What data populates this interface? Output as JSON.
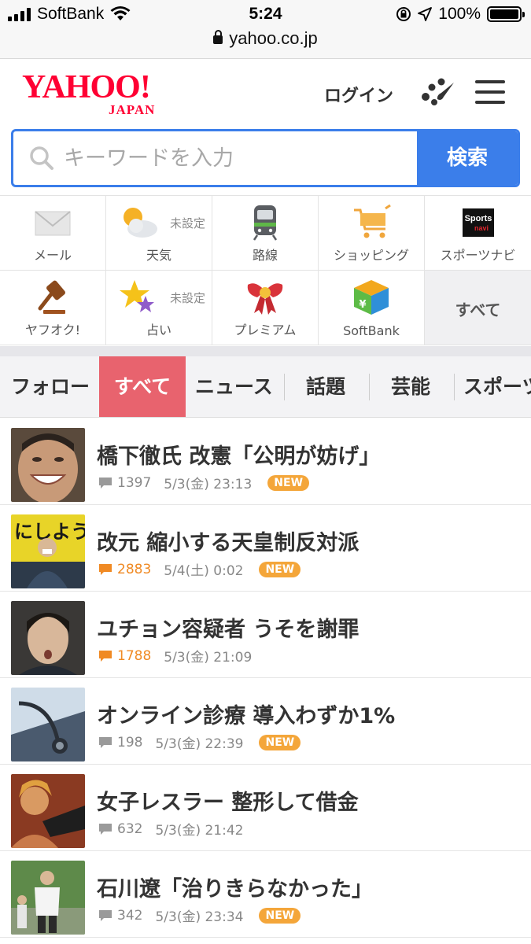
{
  "status_bar": {
    "carrier": "SoftBank",
    "time": "5:24",
    "battery": "100%"
  },
  "browser": {
    "url": "yahoo.co.jp"
  },
  "header": {
    "logo_main": "YAHOO!",
    "logo_sub": "JAPAN",
    "login_label": "ログイン",
    "accent_color": "#ff0033"
  },
  "search": {
    "placeholder": "キーワードを入力",
    "button_label": "検索",
    "accent_color": "#3b7eea"
  },
  "services": [
    {
      "label": "メール",
      "icon": "mail-icon"
    },
    {
      "label": "天気",
      "icon": "weather-icon",
      "note": "未設定"
    },
    {
      "label": "路線",
      "icon": "train-icon"
    },
    {
      "label": "ショッピング",
      "icon": "cart-icon"
    },
    {
      "label": "スポーツナビ",
      "icon": "sportsnavi-icon"
    },
    {
      "label": "ヤフオク!",
      "icon": "auction-hammer-icon"
    },
    {
      "label": "占い",
      "icon": "fortune-stars-icon",
      "note": "未設定"
    },
    {
      "label": "プレミアム",
      "icon": "premium-ribbon-icon"
    },
    {
      "label": "SoftBank",
      "icon": "softbank-cube-icon"
    },
    {
      "label": "すべて"
    }
  ],
  "tabs": [
    {
      "label": "フォロー",
      "active": false
    },
    {
      "label": "すべて",
      "active": true
    },
    {
      "label": "ニュース",
      "active": false
    },
    {
      "label": "話題",
      "active": false
    },
    {
      "label": "芸能",
      "active": false
    },
    {
      "label": "スポーツ",
      "active": false
    }
  ],
  "news": [
    {
      "headline": "橋下徹氏 改憲「公明が妨げ」",
      "comments": "1397",
      "date": "5/3(金) 23:13",
      "new": "NEW",
      "hot": false
    },
    {
      "headline": "改元 縮小する天皇制反対派",
      "comments": "2883",
      "date": "5/4(土) 0:02",
      "new": "NEW",
      "hot": true
    },
    {
      "headline": "ユチョン容疑者 うそを謝罪",
      "comments": "1788",
      "date": "5/3(金) 21:09",
      "new": "",
      "hot": true
    },
    {
      "headline": "オンライン診療 導入わずか1%",
      "comments": "198",
      "date": "5/3(金) 22:39",
      "new": "NEW",
      "hot": false
    },
    {
      "headline": "女子レスラー 整形して借金",
      "comments": "632",
      "date": "5/3(金) 21:42",
      "new": "",
      "hot": false
    },
    {
      "headline": "石川遼「治りきらなかった」",
      "comments": "342",
      "date": "5/3(金) 23:34",
      "new": "NEW",
      "hot": false
    }
  ]
}
